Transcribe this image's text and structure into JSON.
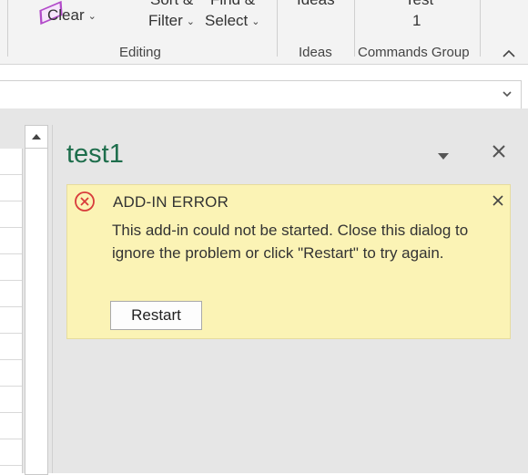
{
  "ribbon": {
    "clear_label": "Clear",
    "sort_filter_line1": "Sort &",
    "sort_filter_line2": "Filter",
    "find_select_line1": "Find &",
    "find_select_line2": "Select",
    "ideas_button_label": "Ideas",
    "test_button_line1": "Test",
    "test_button_line2": "1",
    "groups": {
      "editing": "Editing",
      "ideas": "Ideas",
      "commands": "Commands Group"
    }
  },
  "taskpane": {
    "title": "test1",
    "error": {
      "title": "ADD-IN ERROR",
      "message": "This add-in could not be started. Close this dialog to ignore the problem or click \"Restart\" to try again.",
      "restart_label": "Restart"
    }
  },
  "colors": {
    "pane_title": "#1e6e4c",
    "error_background": "#fbf3b5",
    "error_icon": "#d83b3b"
  }
}
